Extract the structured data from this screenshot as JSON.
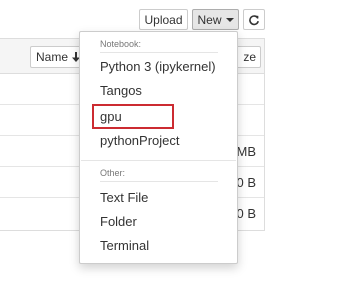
{
  "toolbar": {
    "upload_label": "Upload",
    "new_label": "New",
    "refresh_icon": "refresh-icon"
  },
  "list": {
    "name_column_label": "Name",
    "sort_icon": "sort-down-arrow-icon",
    "size_column_label": "ze",
    "rows": [
      {
        "size": ""
      },
      {
        "size": ""
      },
      {
        "size": "MB"
      },
      {
        "size": "0 B"
      },
      {
        "size": "0 B"
      }
    ]
  },
  "new_menu": {
    "notebook_header": "Notebook:",
    "notebook_items": [
      "Python 3 (ipykernel)",
      "Tangos",
      "gpu",
      "pythonProject"
    ],
    "highlighted_item": "gpu",
    "other_header": "Other:",
    "other_items": [
      "Text File",
      "Folder",
      "Terminal"
    ]
  },
  "colors": {
    "highlight_border": "#cc2b31",
    "header_text": "#777777"
  }
}
